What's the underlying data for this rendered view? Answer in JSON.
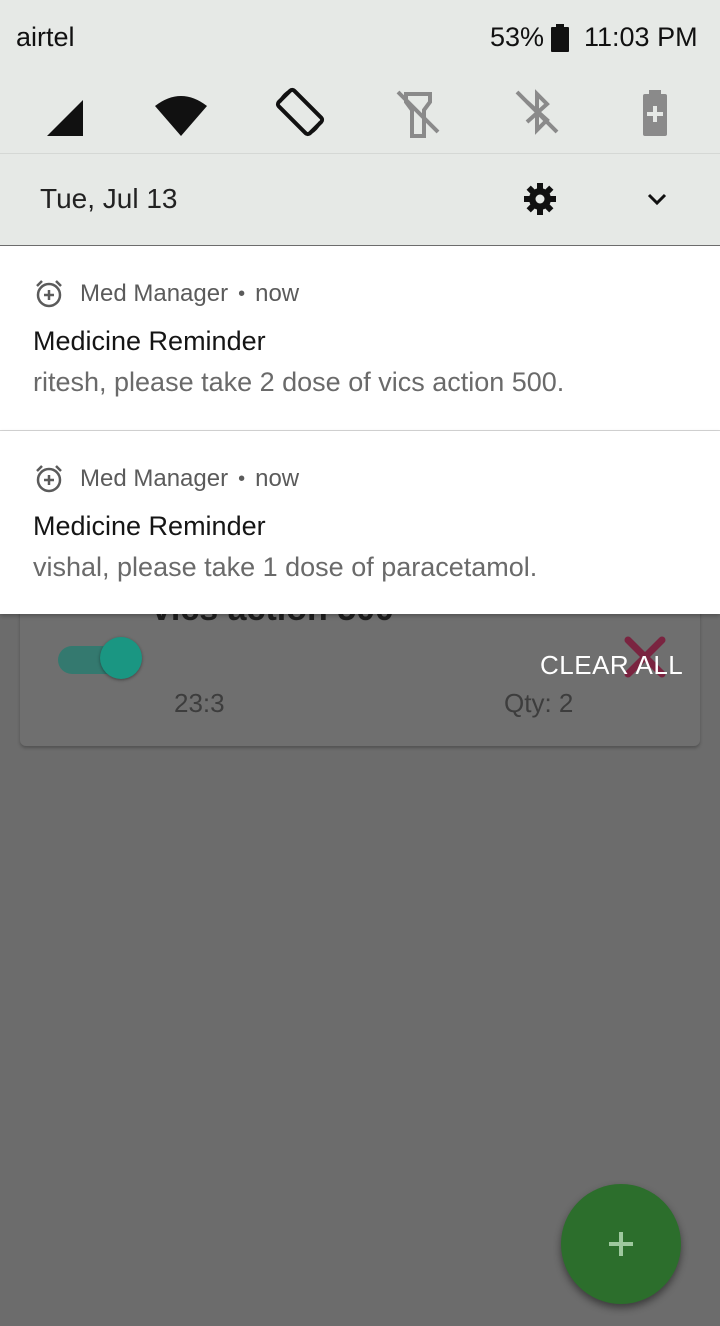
{
  "status_bar": {
    "carrier": "airtel",
    "battery_percent": "53%",
    "time": "11:03 PM"
  },
  "quick_settings": {
    "tiles": [
      {
        "icon": "cellular-signal-icon"
      },
      {
        "icon": "wifi-icon"
      },
      {
        "icon": "auto-rotate-icon"
      },
      {
        "icon": "flashlight-off-icon"
      },
      {
        "icon": "bluetooth-off-icon"
      },
      {
        "icon": "battery-saver-icon"
      }
    ],
    "date": "Tue, Jul 13"
  },
  "notifications": [
    {
      "app": "Med Manager",
      "when": "now",
      "title": "Medicine Reminder",
      "body": "ritesh, please take 2 dose of vics action 500."
    },
    {
      "app": "Med Manager",
      "when": "now",
      "title": "Medicine Reminder",
      "body": "vishal, please take 1 dose of paracetamol."
    }
  ],
  "clear_all_label": "CLEAR ALL",
  "background_app": {
    "card": {
      "title": "vics action 500",
      "time": "23:3",
      "qty": "Qty: 2",
      "enabled": true
    }
  },
  "colors": {
    "shade": "#e6e9e6",
    "toggle": "#1a9682",
    "fab": "#2c6e2c",
    "delete": "#7a2440"
  }
}
